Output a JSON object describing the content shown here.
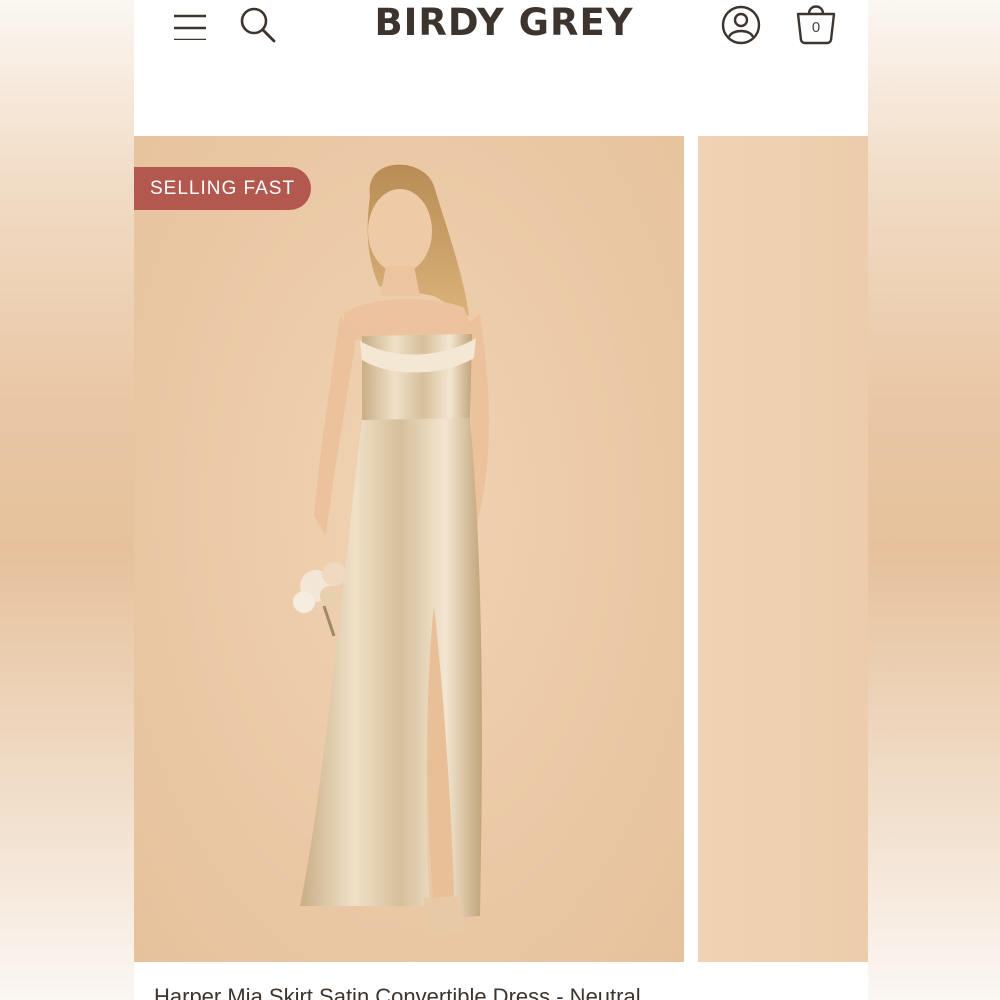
{
  "header": {
    "brand": "BIRDY GREY",
    "menu_icon": "hamburger-menu-icon",
    "search_icon": "search-icon",
    "account_icon": "account-icon",
    "bag_icon": "shopping-bag-icon",
    "bag_count": "0"
  },
  "product": {
    "badge": "SELLING FAST",
    "title": "Harper Mia Skirt Satin Convertible Dress - Neutral"
  },
  "colors": {
    "badge": "#b3584f",
    "brand_text": "#3d342e",
    "backdrop": "#ebc9a6",
    "dress": "#d8c2a0"
  }
}
